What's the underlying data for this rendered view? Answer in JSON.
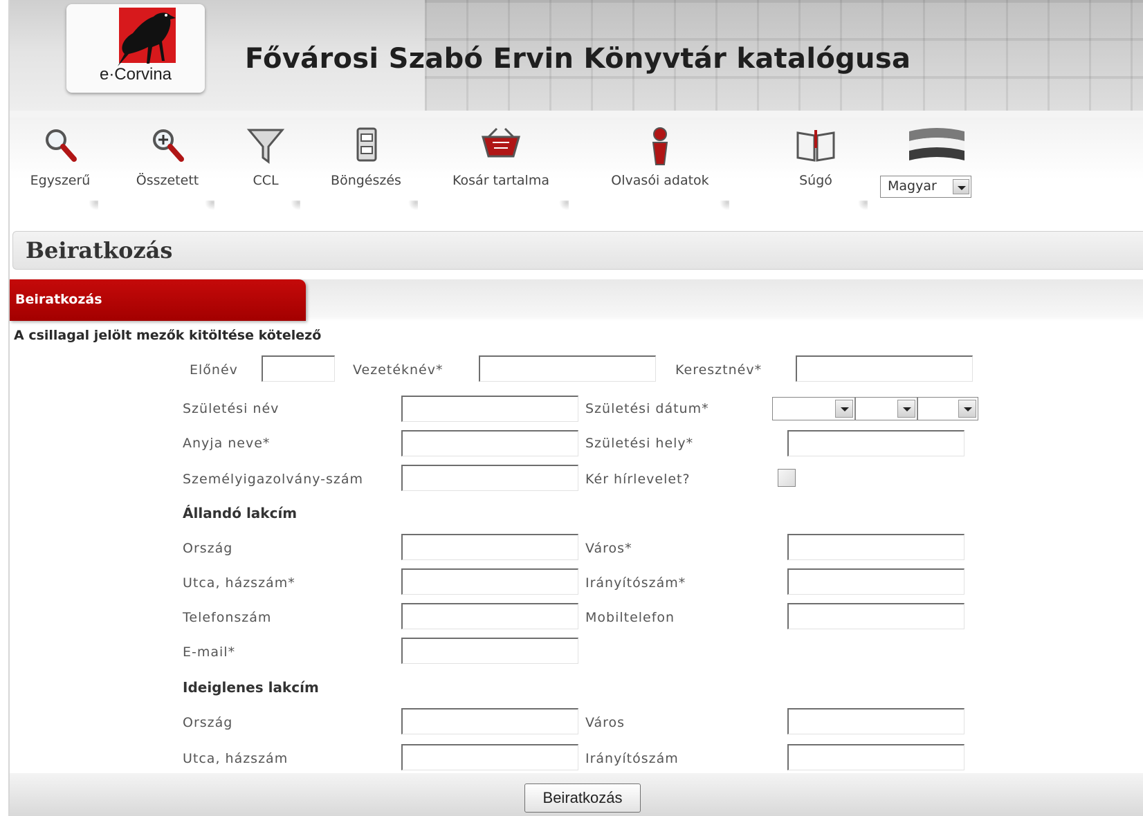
{
  "header": {
    "logo_text": "e·Corvina",
    "title": "Fővárosi Szabó Ervin Könyvtár katalógusa"
  },
  "toolbar": {
    "items": [
      {
        "label": "Egyszerű",
        "icon": "magnifier-icon"
      },
      {
        "label": "Összetett",
        "icon": "magnifier-plus-icon"
      },
      {
        "label": "CCL",
        "icon": "funnel-icon"
      },
      {
        "label": "Böngészés",
        "icon": "drawer-icon"
      },
      {
        "label": "Kosár tartalma",
        "icon": "basket-icon"
      },
      {
        "label": "Olvasói adatok",
        "icon": "reader-icon"
      },
      {
        "label": "Súgó",
        "icon": "book-icon"
      }
    ],
    "language": {
      "icon": "hungarian-flag-icon",
      "selected": "Magyar"
    }
  },
  "page": {
    "title": "Beiratkozás",
    "tab": "Beiratkozás",
    "notice": "A csillagal jelölt mezők kitöltése kötelező"
  },
  "form": {
    "name_row": {
      "prefix": "Előnév",
      "last_name": "Vezetéknév*",
      "first_name": "Keresztnév*"
    },
    "birth_name": "Születési név",
    "birth_date": "Születési dátum*",
    "mother_name": "Anyja neve*",
    "birth_place": "Születési hely*",
    "id_number": "Személyigazolvány-szám",
    "newsletter": "Kér hírlevelet?",
    "permanent": {
      "heading": "Állandó lakcím",
      "country": "Ország",
      "city": "Város*",
      "street": "Utca, házszám*",
      "zip": "Irányítószám*",
      "phone": "Telefonszám",
      "mobile": "Mobiltelefon",
      "email": "E-mail*"
    },
    "temporary": {
      "heading": "Ideiglenes lakcím",
      "country": "Ország",
      "city": "Város",
      "street": "Utca, házszám",
      "zip": "Irányítószám"
    },
    "submit": "Beiratkozás"
  },
  "colors": {
    "accent_red": "#b30000",
    "logo_red": "#d7191c"
  }
}
